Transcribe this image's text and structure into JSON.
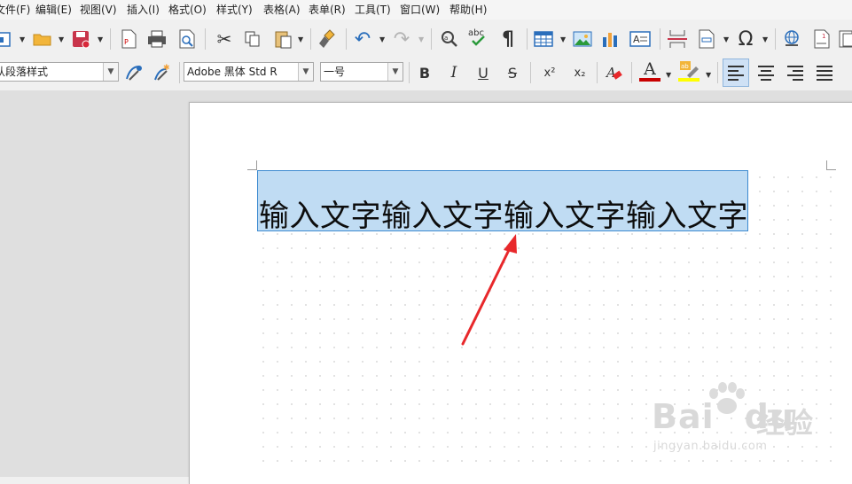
{
  "menubar": {
    "items": [
      "文件(F)",
      "编辑(E)",
      "视图(V)",
      "插入(I)",
      "格式(O)",
      "样式(Y)",
      "表格(A)",
      "表单(R)",
      "工具(T)",
      "窗口(W)",
      "帮助(H)"
    ]
  },
  "formatting": {
    "paragraph_style": "默认段落样式",
    "font_name": "Adobe 黑体 Std R",
    "font_size": "一号",
    "bold_label": "B",
    "italic_label": "I",
    "underline_label": "U",
    "strike_label": "S",
    "superscript_label": "x²",
    "subscript_label": "x₂",
    "font_color_label": "A"
  },
  "document": {
    "text": "输入文字输入文字输入文字输入文字"
  },
  "watermark": {
    "brand": "Bai",
    "brand2": "du",
    "cn": "经验",
    "url": "jingyan.baidu.com"
  },
  "colors": {
    "selection": "#c0dcf3",
    "selection_border": "#3d8ad0",
    "arrow": "#e8282b",
    "font_color_bar": "#c80000",
    "highlight_bar": "#ffff00"
  }
}
